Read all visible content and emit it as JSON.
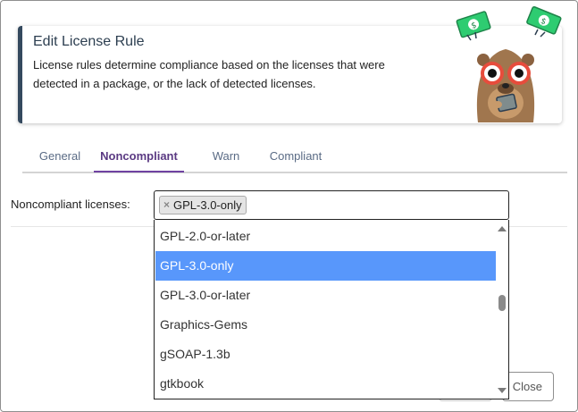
{
  "header": {
    "title": "Edit License Rule",
    "description": "License rules determine compliance based on the licenses that were detected in a package, or the lack of detected licenses.",
    "mascot_icon": "mascot-with-money-icon"
  },
  "tabs": [
    {
      "label": "General",
      "active": false
    },
    {
      "label": "Noncompliant",
      "active": true
    },
    {
      "label": "Warn",
      "active": false
    },
    {
      "label": "Compliant",
      "active": false
    }
  ],
  "field": {
    "label": "Noncompliant licenses:",
    "selected_chips": [
      {
        "label": "GPL-3.0-only",
        "remove_symbol": "×"
      }
    ]
  },
  "dropdown": {
    "options": [
      {
        "label": "GPL-2.0-or-later",
        "highlighted": false
      },
      {
        "label": "GPL-3.0-only",
        "highlighted": true
      },
      {
        "label": "GPL-3.0-or-later",
        "highlighted": false
      },
      {
        "label": "Graphics-Gems",
        "highlighted": false
      },
      {
        "label": "gSOAP-1.3b",
        "highlighted": false
      },
      {
        "label": "gtkbook",
        "highlighted": false
      }
    ],
    "highlight_color": "#5897fb"
  },
  "footer": {
    "close_label": "Close"
  },
  "colors": {
    "accent_bar": "#34495e",
    "active_tab": "#6f42a1"
  }
}
